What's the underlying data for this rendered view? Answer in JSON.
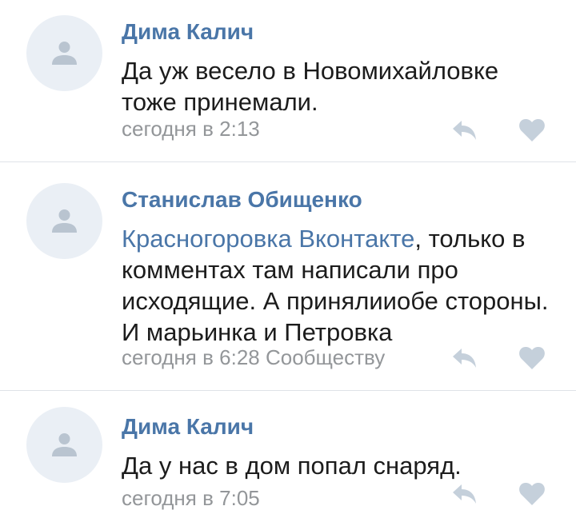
{
  "comments": [
    {
      "author": "Дима Калич",
      "text": "Да уж весело в Новомихайловке тоже принемали.",
      "meta": "сегодня в 2:13"
    },
    {
      "author": "Станислав Обищенко",
      "mention": "Красногоровка Вконтакте",
      "text": ", только в комментах там написали про исходящие. А принялииобе стороны. И марьинка и Петровка",
      "meta": "сегодня в 6:28 Сообществу"
    },
    {
      "author": "Дима Калич",
      "text": "Да у нас в дом попал снаряд.",
      "meta": "сегодня в 7:05"
    }
  ],
  "icons": {
    "avatar": "user-silhouette-icon",
    "reply": "reply-arrow-icon",
    "like": "heart-icon"
  },
  "colors": {
    "author": "#4a76a8",
    "link": "#4a76a8",
    "text": "#1c1c1c",
    "meta": "#939699",
    "icon": "#c5d0db",
    "avatar_bg": "#eaeff5"
  }
}
